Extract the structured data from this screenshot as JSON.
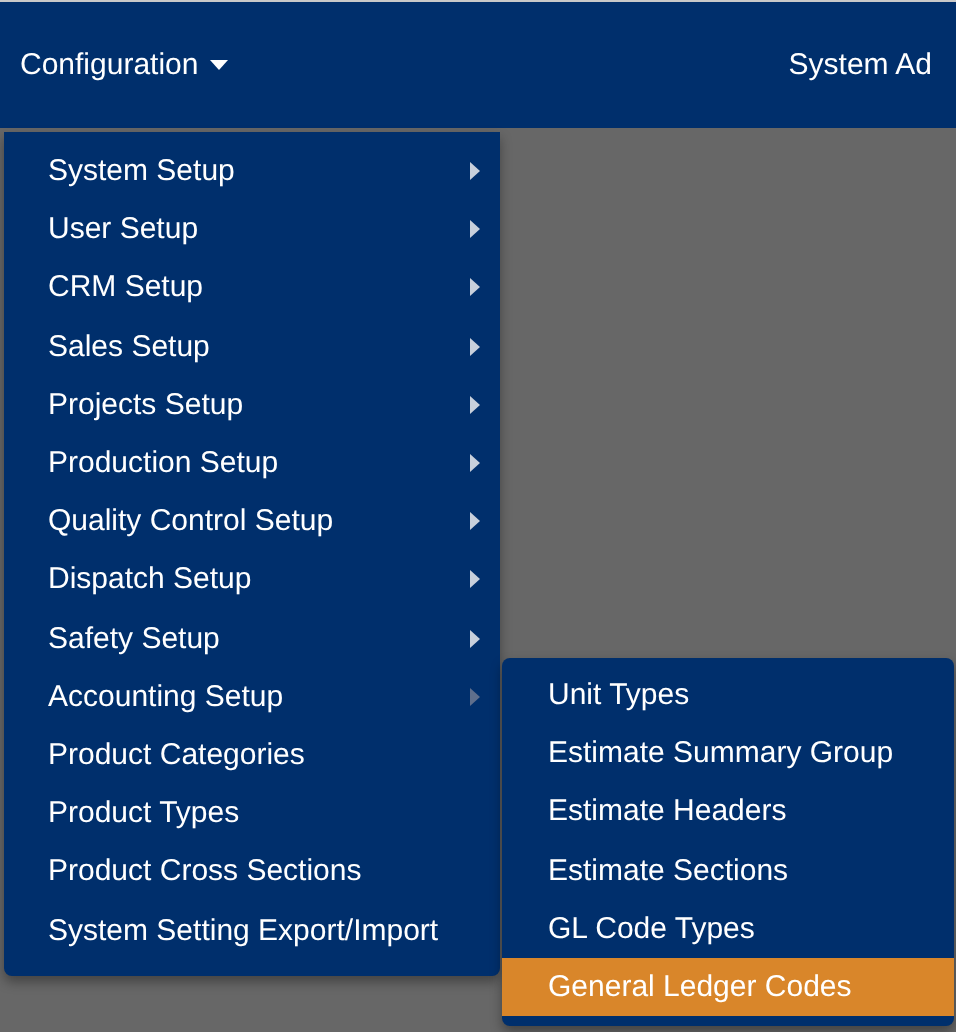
{
  "navbar": {
    "menu_label": "Configuration",
    "user_label": "System Ad"
  },
  "menu": [
    {
      "label": "System Setup",
      "kind": "submenu",
      "expanded": false
    },
    {
      "label": "User Setup",
      "kind": "submenu",
      "expanded": false
    },
    {
      "label": "CRM Setup",
      "kind": "submenu",
      "expanded": false
    },
    {
      "label": "Sales Setup",
      "kind": "submenu",
      "expanded": false
    },
    {
      "label": "Projects Setup",
      "kind": "submenu",
      "expanded": false
    },
    {
      "label": "Production Setup",
      "kind": "submenu",
      "expanded": false
    },
    {
      "label": "Quality Control Setup",
      "kind": "submenu",
      "expanded": false
    },
    {
      "label": "Dispatch Setup",
      "kind": "submenu",
      "expanded": false
    },
    {
      "label": "Safety Setup",
      "kind": "submenu",
      "expanded": false
    },
    {
      "label": "Accounting Setup",
      "kind": "submenu",
      "expanded": true
    },
    {
      "label": "Product Categories",
      "kind": "link"
    },
    {
      "label": "Product Types",
      "kind": "link"
    },
    {
      "label": "Product Cross Sections",
      "kind": "link"
    },
    {
      "label": "System Setting Export/Import",
      "kind": "link"
    }
  ],
  "submenu": [
    {
      "label": "Unit Types",
      "selected": false
    },
    {
      "label": "Estimate Summary Group",
      "selected": false
    },
    {
      "label": "Estimate Headers",
      "selected": false
    },
    {
      "label": "Estimate Sections",
      "selected": false
    },
    {
      "label": "GL Code Types",
      "selected": false
    },
    {
      "label": "General Ledger Codes",
      "selected": true
    }
  ]
}
